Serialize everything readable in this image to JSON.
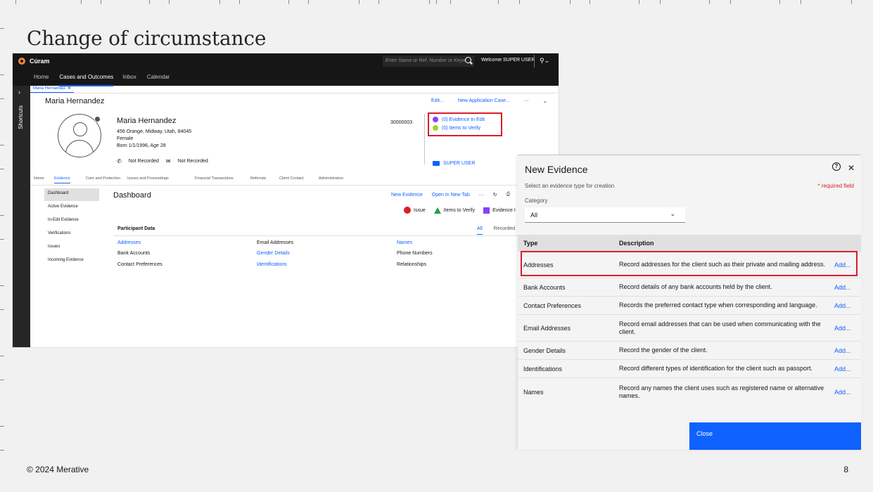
{
  "slide": {
    "title": "Change of circumstance",
    "copyright": "© 2024 Merative",
    "page_number": "8"
  },
  "app": {
    "brand": "Cúram",
    "search_placeholder": "Enter Name or Ref. Number or Keyw",
    "welcome": "Welcome SUPER USER",
    "nav_tabs": [
      "Home",
      "Cases and Outcomes",
      "Inbox",
      "Calendar"
    ],
    "active_nav": "Cases and Outcomes",
    "shortcuts_label": "Shortcuts",
    "case_tab": "Maria Hernandez",
    "case_title": "Maria Hernandez",
    "header_actions": {
      "edit": "Edit...",
      "new_case": "New Application Case..."
    },
    "person": {
      "name": "Maria Hernandez",
      "address": "456 Orange, Midway, Utah, 84045",
      "gender": "Female",
      "born": "Born 1/1/1996, Age 28",
      "phone": "Not Recorded",
      "email": "Not Recorded"
    },
    "reference_number": "30000003",
    "evidence_in_edit": "(0) Evidence In Edit",
    "items_to_verify": "(0) Items to Verify",
    "owner": "SUPER USER",
    "content_tabs": [
      "Home",
      "Evidence",
      "Care and Protection",
      "Issues and Proceedings",
      "Financial Transactions",
      "Referrals",
      "Client Contact",
      "Administration"
    ],
    "left_nav": [
      "Dashboard",
      "Active Evidence",
      "In-Edit Evidence",
      "Verifications",
      "Issues",
      "Incoming Evidence"
    ],
    "dashboard": {
      "title": "Dashboard",
      "new_evidence": "New Evidence",
      "open_new_tab": "Open In New Tab",
      "issue": "Issue",
      "items_to_verify": "Items to Verify",
      "evidence_in_edit": "Evidence I",
      "participant_data": "Participant Data",
      "filter_all": "All",
      "filter_recorded": "Recorded",
      "col1": [
        "Addresses",
        "Bank Accounts",
        "Contact Preferences"
      ],
      "col2": [
        "Email Addresses",
        "Gender Details",
        "Identifications"
      ],
      "col3": [
        "Names",
        "Phone Numbers",
        "Relationships"
      ]
    }
  },
  "modal": {
    "title": "New Evidence",
    "subtitle": "Select an evidence type for creation",
    "required": "* required field",
    "category_label": "Category",
    "category_value": "All",
    "col_type": "Type",
    "col_description": "Description",
    "add_label": "Add...",
    "rows": [
      {
        "type": "Addresses",
        "description": "Record addresses for the client such as their private and mailing address."
      },
      {
        "type": "Bank Accounts",
        "description": "Record details of any bank accounts held by the client."
      },
      {
        "type": "Contact Preferences",
        "description": "Records the preferred contact type when corresponding and language."
      },
      {
        "type": "Email Addresses",
        "description": "Record email addresses that can be used when communicating with the client."
      },
      {
        "type": "Gender Details",
        "description": "Record the gender of the client."
      },
      {
        "type": "Identifications",
        "description": "Record different types of identification for the client such as passport."
      },
      {
        "type": "Names",
        "description": "Record any names the client uses such as registered name or alternative names."
      }
    ],
    "close": "Close"
  },
  "colors": {
    "accent": "#0f62fe",
    "highlight": "#da1e28",
    "topbar": "#161616"
  }
}
